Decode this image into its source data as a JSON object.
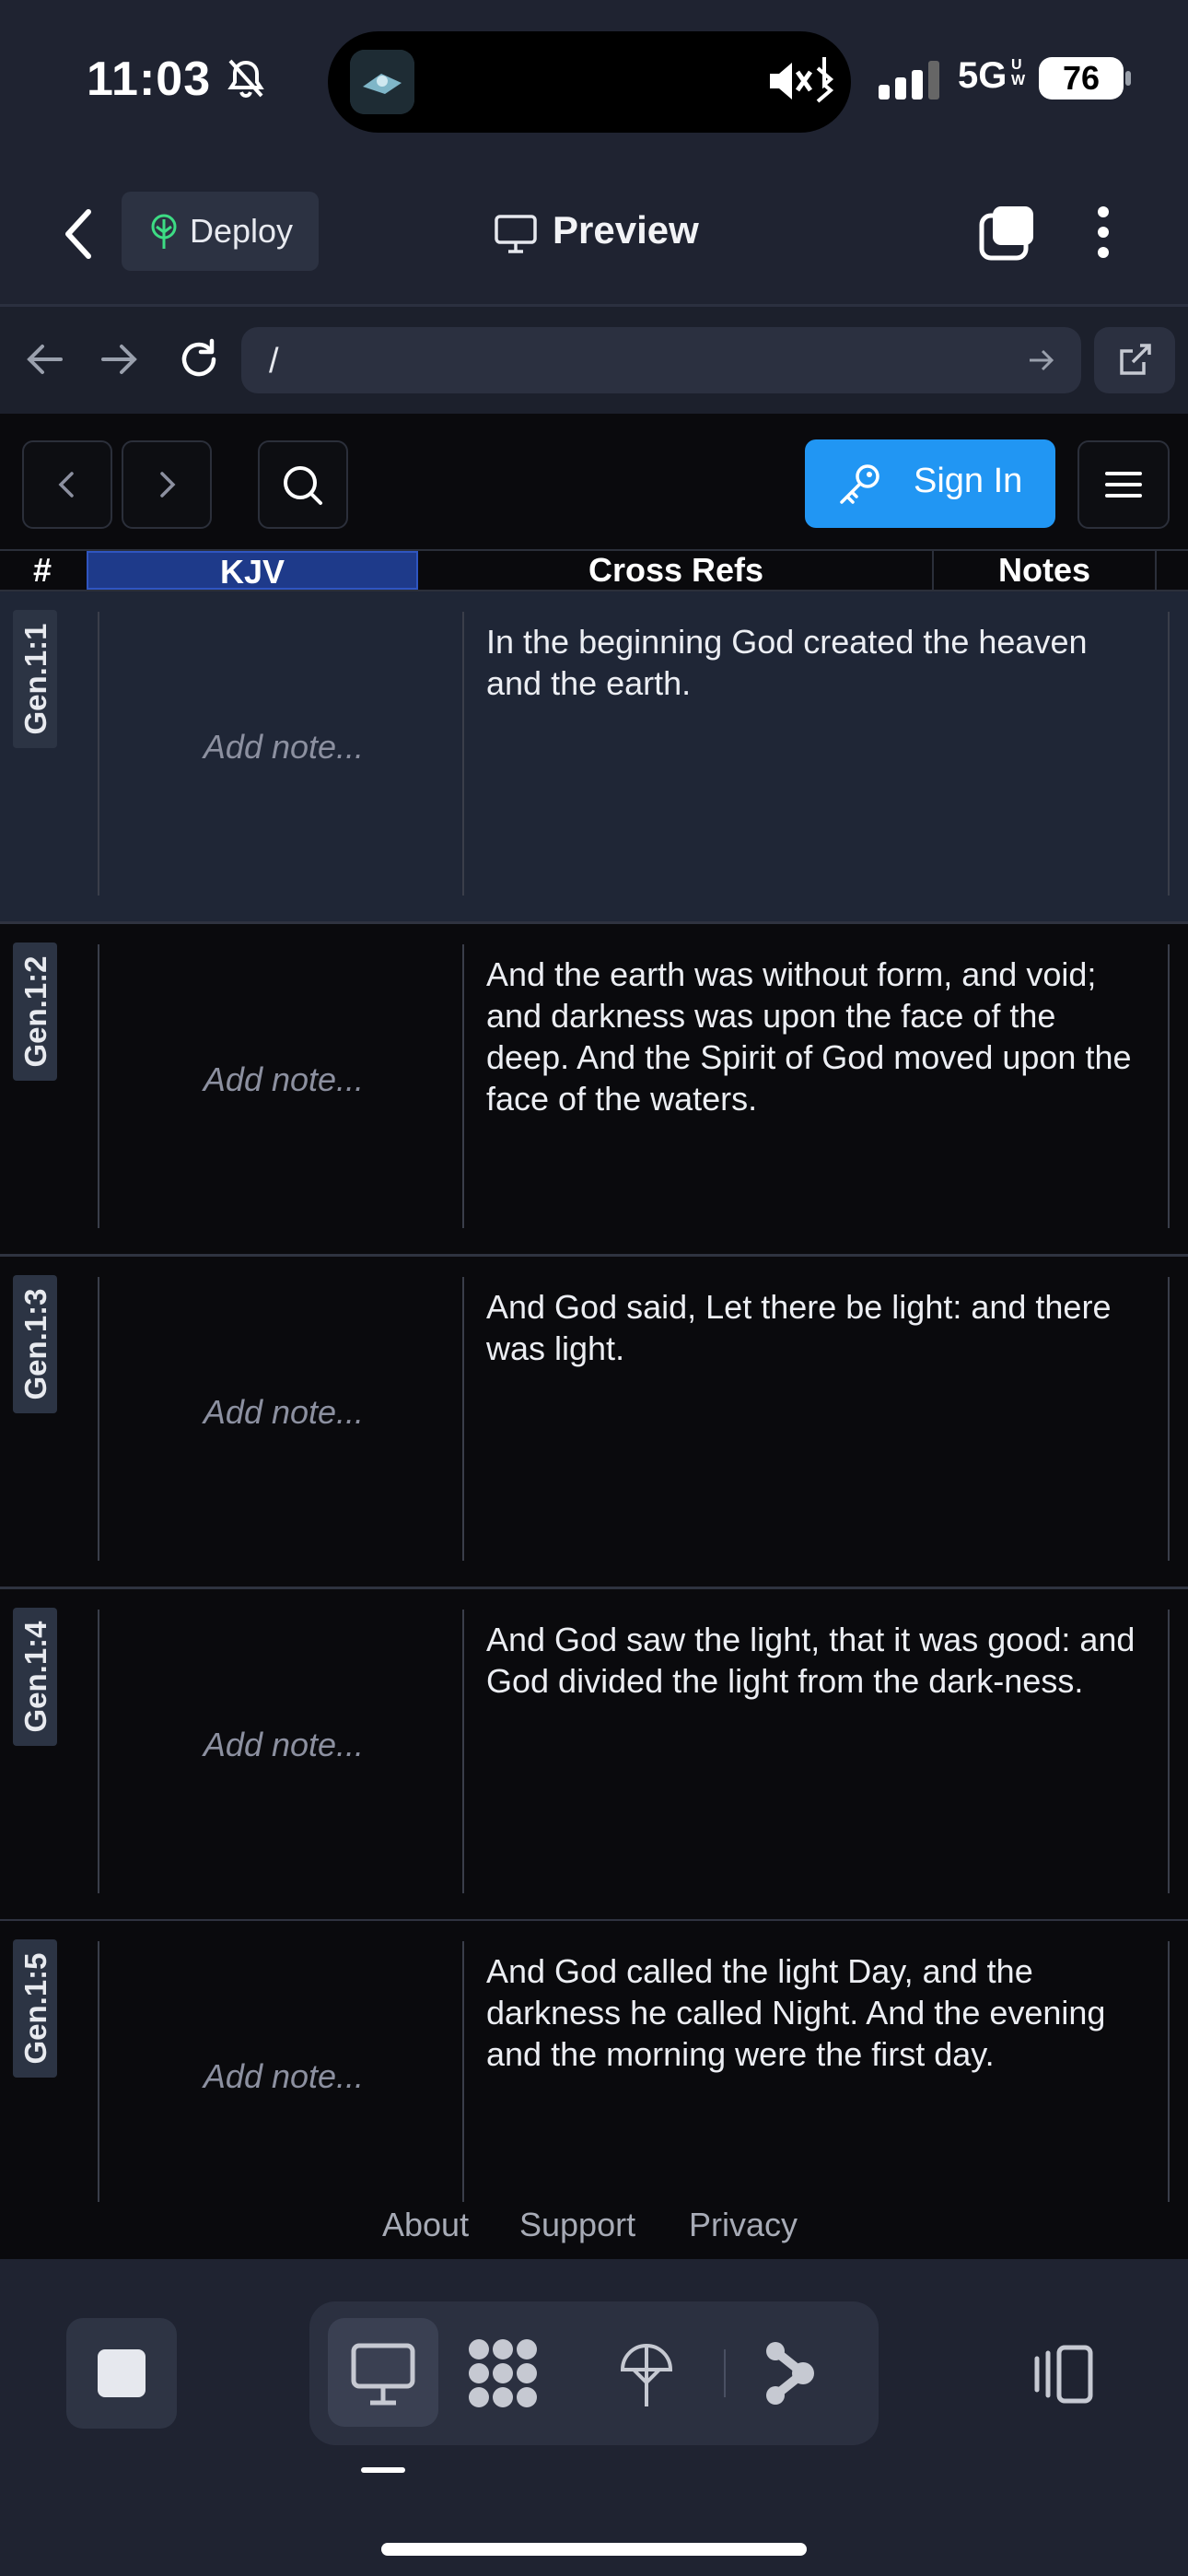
{
  "status_bar": {
    "time": "11:03",
    "network": "5G",
    "network_sub": "UW",
    "battery": "76"
  },
  "header": {
    "deploy_label": "Deploy",
    "preview_label": "Preview"
  },
  "url_bar": {
    "url": "/"
  },
  "toolbar": {
    "sign_in_label": "Sign In"
  },
  "columns": {
    "number": "#",
    "kjv": "KJV",
    "cross_refs": "Cross Refs",
    "notes": "Notes"
  },
  "rows": [
    {
      "ref": "Gen.1:1",
      "note_placeholder": "Add note...",
      "text": "In the beginning God created the heaven and the earth."
    },
    {
      "ref": "Gen.1:2",
      "note_placeholder": "Add note...",
      "text": "And the earth was without form, and void; and darkness was upon the face of the deep. And the Spirit of God moved upon the face of the waters."
    },
    {
      "ref": "Gen.1:3",
      "note_placeholder": "Add note...",
      "text": "And God said, Let there be light: and there was light."
    },
    {
      "ref": "Gen.1:4",
      "note_placeholder": "Add note...",
      "text": "And God saw the light, that it was good: and God divided the light from the dark-ness."
    },
    {
      "ref": "Gen.1:5",
      "note_placeholder": "Add note...",
      "text": "And God called the light Day, and the darkness he called Night. And the evening and the morning were the first day."
    }
  ],
  "footer": {
    "about": "About",
    "support": "Support",
    "privacy": "Privacy"
  },
  "icons": [
    "bell-slash-icon",
    "app-icon",
    "speaker-mute-icon",
    "bluetooth-icon",
    "signal-icon",
    "chevron-left-icon",
    "deploy-tree-icon",
    "monitor-icon",
    "windows-icon",
    "more-vertical-icon",
    "arrow-left-icon",
    "arrow-right-icon",
    "reload-icon",
    "go-arrow-icon",
    "external-link-icon",
    "search-icon",
    "key-icon",
    "hamburger-icon",
    "stop-icon",
    "desktop-icon",
    "grid-icon",
    "tree-icon",
    "share-icon",
    "sidebar-toggle-icon"
  ],
  "colors": {
    "accent": "#2196f3",
    "kjv_header": "#1e3a8a",
    "selected_row": "#1f2636",
    "chrome": "#1f2331",
    "deploy_icon": "#3ddc84"
  }
}
